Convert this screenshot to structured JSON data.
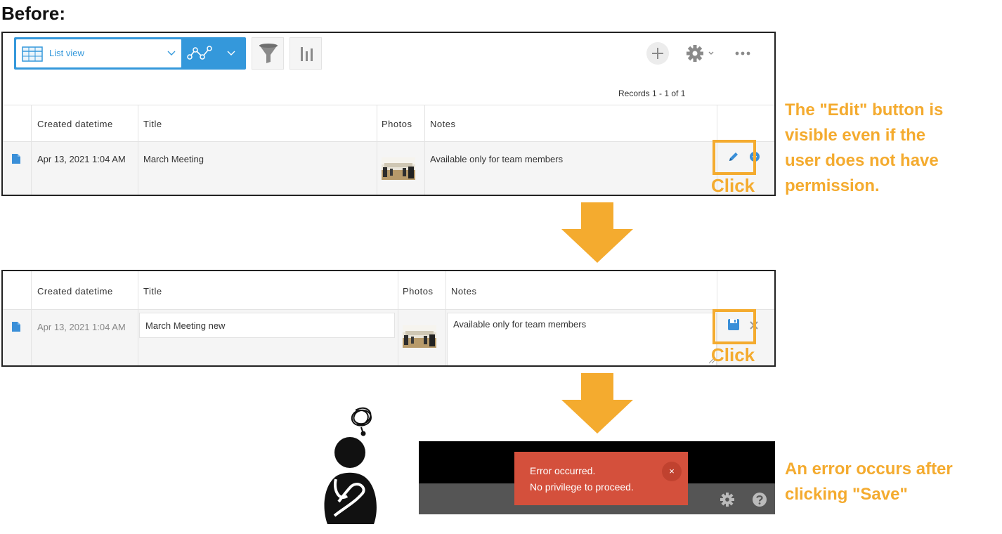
{
  "heading": "Before:",
  "panel1": {
    "view_label": "List view",
    "records_text": "Records 1 - 1 of 1",
    "columns": [
      "Created datetime",
      "Title",
      "Photos",
      "Notes"
    ],
    "row": {
      "created": "Apr 13, 2021 1:04 AM",
      "title": "March Meeting",
      "notes": "Available only for team members"
    },
    "click_label": "Click"
  },
  "panel2": {
    "columns": [
      "Created datetime",
      "Title",
      "Photos",
      "Notes"
    ],
    "row": {
      "created": "Apr 13, 2021 1:04 AM",
      "title_value": "March Meeting new",
      "notes_value": "Available only for team members"
    },
    "click_label": "Click"
  },
  "notes": {
    "edit_lines": [
      "The \"Edit\" button is",
      "visible even if the",
      "user does not have",
      "permission."
    ],
    "error_lines": [
      "An error occurs after",
      "clicking \"Save\""
    ]
  },
  "error": {
    "line1": "Error occurred.",
    "line2": "No privilege to proceed.",
    "close": "×"
  },
  "colors": {
    "accent": "#f4ab2f",
    "blue": "#3498db",
    "error_red": "#d4503c"
  }
}
